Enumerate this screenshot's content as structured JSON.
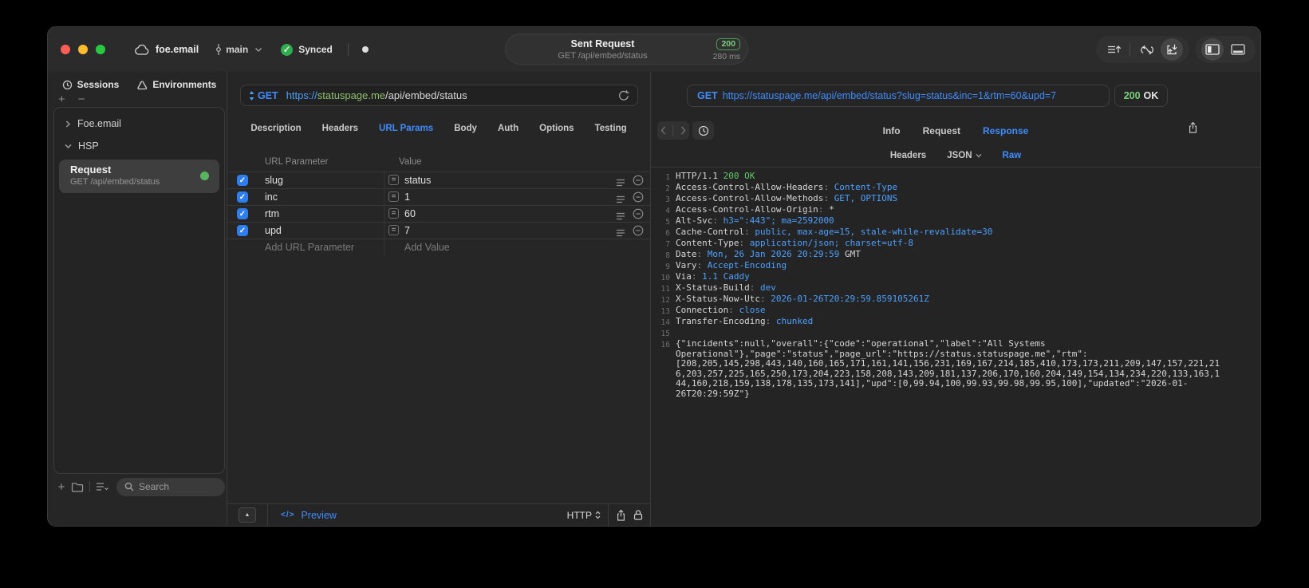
{
  "colors": {
    "accent": "#3f8cff",
    "green": "#58b55c",
    "status_green": "#79d07b",
    "host_green": "#8fbf6f"
  },
  "window": {
    "project": "foe.email",
    "branch": "main",
    "sync_label": "Synced",
    "title": "Sent Request",
    "subtitle": "GET /api/embed/status",
    "status_code": "200",
    "duration": "280 ms"
  },
  "sidebar": {
    "tabs": [
      {
        "id": "sessions",
        "label": "Sessions",
        "icon": "clock-icon"
      },
      {
        "id": "environments",
        "label": "Environments",
        "icon": "layers-icon"
      }
    ],
    "groups": [
      {
        "label": "Foe.email",
        "expanded": false
      },
      {
        "label": "HSP",
        "expanded": true
      }
    ],
    "request": {
      "title": "Request",
      "subtitle": "GET /api/embed/status"
    },
    "search_placeholder": "Search"
  },
  "request_editor": {
    "method": "GET",
    "url": {
      "scheme": "https://",
      "host": "statuspage.me",
      "path": "/api/embed/status"
    },
    "tabs": [
      "Description",
      "Headers",
      "URL Params",
      "Body",
      "Auth",
      "Options",
      "Testing"
    ],
    "active_tab": "URL Params",
    "params": {
      "columns": [
        "URL Parameter",
        "Value"
      ],
      "rows": [
        {
          "enabled": true,
          "name": "slug",
          "value": "status"
        },
        {
          "enabled": true,
          "name": "inc",
          "value": "1"
        },
        {
          "enabled": true,
          "name": "rtm",
          "value": "60"
        },
        {
          "enabled": true,
          "name": "upd",
          "value": "7"
        }
      ],
      "add_name_placeholder": "Add URL Parameter",
      "add_value_placeholder": "Add Value"
    },
    "footer": {
      "preview": "Preview",
      "protocol": "HTTP"
    }
  },
  "response_viewer": {
    "request_line": {
      "method": "GET",
      "url": "https://statuspage.me/api/embed/status?slug=status&inc=1&rtm=60&upd=7"
    },
    "status_code": "200",
    "status_text": "OK",
    "tabs": [
      "Info",
      "Request",
      "Response"
    ],
    "active_tab": "Response",
    "subtabs": [
      "Headers",
      "JSON",
      "Raw"
    ],
    "active_subtab": "Raw",
    "lines": [
      {
        "n": "1",
        "segs": [
          [
            "HTTP/1.1 ",
            "plain"
          ],
          [
            "200 OK",
            "status"
          ]
        ]
      },
      {
        "n": "2",
        "segs": [
          [
            "Access-Control-Allow-Headers",
            "plain"
          ],
          [
            ": ",
            "punct"
          ],
          [
            "Content-Type",
            "value"
          ]
        ]
      },
      {
        "n": "3",
        "segs": [
          [
            "Access-Control-Allow-Methods",
            "plain"
          ],
          [
            ": ",
            "punct"
          ],
          [
            "GET, OPTIONS",
            "value"
          ]
        ]
      },
      {
        "n": "4",
        "segs": [
          [
            "Access-Control-Allow-Origin",
            "plain"
          ],
          [
            ": ",
            "punct"
          ],
          [
            "*",
            "plain"
          ]
        ]
      },
      {
        "n": "5",
        "segs": [
          [
            "Alt-Svc",
            "plain"
          ],
          [
            ": ",
            "punct"
          ],
          [
            "h3=\":443\"; ma=2592000",
            "value"
          ]
        ]
      },
      {
        "n": "6",
        "segs": [
          [
            "Cache-Control",
            "plain"
          ],
          [
            ": ",
            "punct"
          ],
          [
            "public, max-age=15, stale-while-revalidate=30",
            "value"
          ]
        ]
      },
      {
        "n": "7",
        "segs": [
          [
            "Content-Type",
            "plain"
          ],
          [
            ": ",
            "punct"
          ],
          [
            "application/json; charset=utf-8",
            "value"
          ]
        ]
      },
      {
        "n": "8",
        "segs": [
          [
            "Date",
            "plain"
          ],
          [
            ": ",
            "punct"
          ],
          [
            "Mon, 26 Jan 2026 20:29:59",
            "value"
          ],
          [
            " GMT",
            "plain"
          ]
        ]
      },
      {
        "n": "9",
        "segs": [
          [
            "Vary",
            "plain"
          ],
          [
            ": ",
            "punct"
          ],
          [
            "Accept-Encoding",
            "value"
          ]
        ]
      },
      {
        "n": "10",
        "segs": [
          [
            "Via",
            "plain"
          ],
          [
            ": ",
            "punct"
          ],
          [
            "1.1 Caddy",
            "value"
          ]
        ]
      },
      {
        "n": "11",
        "segs": [
          [
            "X-Status-Build",
            "plain"
          ],
          [
            ": ",
            "punct"
          ],
          [
            "dev",
            "value"
          ]
        ]
      },
      {
        "n": "12",
        "segs": [
          [
            "X-Status-Now-Utc",
            "plain"
          ],
          [
            ": ",
            "punct"
          ],
          [
            "2026-01-26T20:29:59.859105261Z",
            "value"
          ]
        ]
      },
      {
        "n": "13",
        "segs": [
          [
            "Connection",
            "plain"
          ],
          [
            ": ",
            "punct"
          ],
          [
            "close",
            "value"
          ]
        ]
      },
      {
        "n": "14",
        "segs": [
          [
            "Transfer-Encoding",
            "plain"
          ],
          [
            ": ",
            "punct"
          ],
          [
            "chunked",
            "value"
          ]
        ]
      },
      {
        "n": "15",
        "segs": []
      },
      {
        "n": "16",
        "segs": [
          [
            "{\"incidents\":null,\"overall\":{\"code\":\"operational\",\"label\":\"All Systems Operational\"},\"page\":\"status\",\"page_url\":\"https://status.statuspage.me\",\"rtm\":[208,205,145,298,443,140,160,165,171,161,141,156,231,169,167,214,185,410,173,173,211,209,147,157,221,216,203,257,225,165,250,173,204,223,158,208,143,209,181,137,206,170,160,204,149,154,134,234,220,133,163,144,160,218,159,138,178,135,173,141],\"upd\":[0,99.94,100,99.93,99.98,99.95,100],\"updated\":\"2026-01-26T20:29:59Z\"}",
            "plain"
          ]
        ]
      }
    ]
  }
}
